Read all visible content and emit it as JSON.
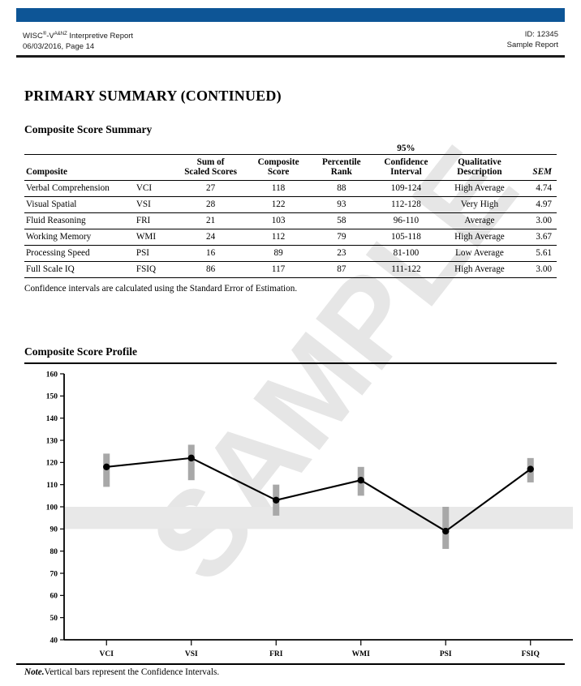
{
  "header": {
    "product": "WISC",
    "registered_mark": "®",
    "product_suffix": "-V",
    "edition_superscript": "A&NZ",
    "report_type": " Interpretive Report",
    "date_page": "06/03/2016, Page 14",
    "id_label": "ID: 12345",
    "report_label": "Sample Report",
    "bar_color": "#0d5596"
  },
  "page_title": "PRIMARY SUMMARY (CONTINUED)",
  "watermark_text": "SAMPLE",
  "composite_summary": {
    "title": "Composite Score Summary",
    "ci_level_label": "95%",
    "columns": [
      "Composite",
      "",
      "Sum of\nScaled Scores",
      "Composite\nScore",
      "Percentile\nRank",
      "Confidence\nInterval",
      "Qualitative\nDescription",
      "SEM"
    ],
    "columns_line1": [
      "",
      "",
      "Sum of",
      "Composite",
      "Percentile",
      "Confidence",
      "Qualitative",
      ""
    ],
    "columns_line2": [
      "Composite",
      "",
      "Scaled Scores",
      "Score",
      "Rank",
      "Interval",
      "Description",
      "SEM"
    ],
    "rows": [
      {
        "name": "Verbal Comprehension",
        "abbr": "VCI",
        "sum": "27",
        "composite": "118",
        "percentile": "88",
        "ci": "109-124",
        "qualitative": "High Average",
        "sem": "4.74"
      },
      {
        "name": "Visual Spatial",
        "abbr": "VSI",
        "sum": "28",
        "composite": "122",
        "percentile": "93",
        "ci": "112-128",
        "qualitative": "Very High",
        "sem": "4.97"
      },
      {
        "name": "Fluid Reasoning",
        "abbr": "FRI",
        "sum": "21",
        "composite": "103",
        "percentile": "58",
        "ci": "96-110",
        "qualitative": "Average",
        "sem": "3.00"
      },
      {
        "name": "Working Memory",
        "abbr": "WMI",
        "sum": "24",
        "composite": "112",
        "percentile": "79",
        "ci": "105-118",
        "qualitative": "High Average",
        "sem": "3.67"
      },
      {
        "name": "Processing Speed",
        "abbr": "PSI",
        "sum": "16",
        "composite": "89",
        "percentile": "23",
        "ci": "81-100",
        "qualitative": "Low Average",
        "sem": "5.61"
      },
      {
        "name": "Full Scale IQ",
        "abbr": "FSIQ",
        "sum": "86",
        "composite": "117",
        "percentile": "87",
        "ci": "111-122",
        "qualitative": "High Average",
        "sem": "3.00"
      }
    ],
    "note": "Confidence intervals are calculated using the Standard Error of Estimation."
  },
  "composite_profile": {
    "title": "Composite Score Profile"
  },
  "footer": {
    "note_label": "Note.",
    "note_text": "Vertical bars represent the Confidence Intervals."
  },
  "chart_data": {
    "type": "line",
    "title": "Composite Score Profile",
    "xlabel": "",
    "ylabel": "",
    "categories": [
      "VCI",
      "VSI",
      "FRI",
      "WMI",
      "PSI",
      "FSIQ"
    ],
    "values": [
      118,
      122,
      103,
      112,
      89,
      117
    ],
    "error_bars": {
      "label": "95% Confidence Interval",
      "lower": [
        109,
        112,
        96,
        105,
        81,
        111
      ],
      "upper": [
        124,
        128,
        110,
        118,
        100,
        122
      ]
    },
    "ylim": [
      40,
      160
    ],
    "yticks": [
      40,
      50,
      60,
      70,
      80,
      90,
      100,
      110,
      120,
      130,
      140,
      150,
      160
    ],
    "average_band": {
      "from": 90,
      "to": 100,
      "color": "#e8e8e8"
    },
    "grid": false,
    "legend": false,
    "line_color": "#000000",
    "marker_color": "#000000",
    "errorbar_color": "#a8a8a8"
  }
}
